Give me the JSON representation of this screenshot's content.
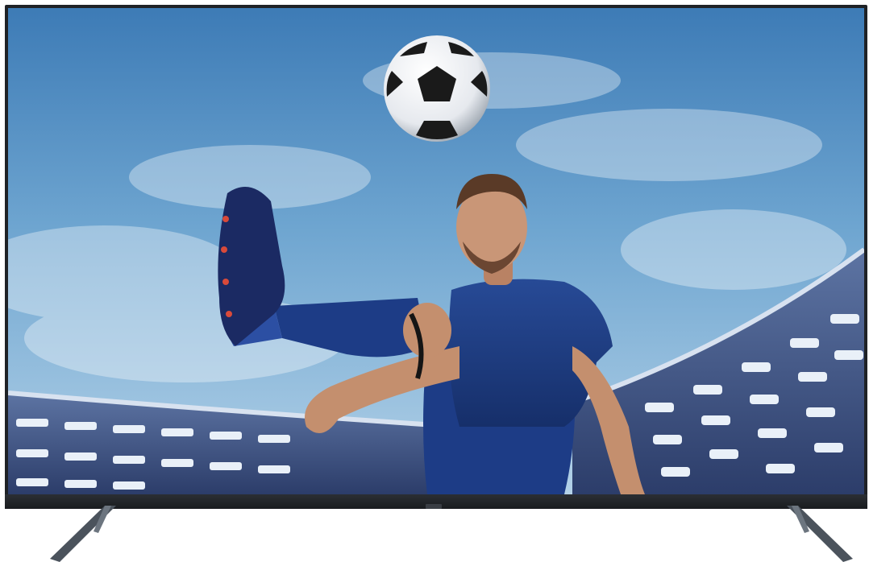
{
  "scene": {
    "subject": "tv-display",
    "icons": [
      "soccer-ball-icon",
      "tv-stand-icon"
    ],
    "colors": {
      "sky_top": "#3f7fb8",
      "sky_mid": "#7fb2d8",
      "sky_low": "#a9cbe4",
      "jersey": "#1f3f8a",
      "stadium": "#4a5f8c",
      "bezel": "#1f2226"
    }
  }
}
